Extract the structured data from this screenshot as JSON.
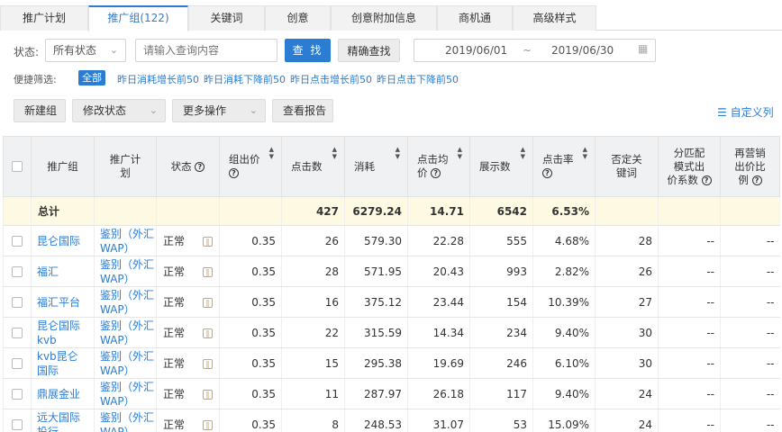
{
  "tabs": [
    {
      "label": "推广计划"
    },
    {
      "label": "推广组(122)"
    },
    {
      "label": "关键词"
    },
    {
      "label": "创意"
    },
    {
      "label": "创意附加信息"
    },
    {
      "label": "商机通"
    },
    {
      "label": "高级样式"
    }
  ],
  "filters": {
    "status_label": "状态:",
    "status_value": "所有状态",
    "search_placeholder": "请输入查询内容",
    "search_button": "查 找",
    "exact_button": "精确查找",
    "date_start": "2019/06/01",
    "date_sep": "~",
    "date_end": "2019/06/30"
  },
  "quick": {
    "label": "便捷筛选:",
    "all": "全部",
    "items": [
      "昨日消耗增长前50",
      "昨日消耗下降前50",
      "昨日点击增长前50",
      "昨日点击下降前50"
    ]
  },
  "actions": {
    "new_group": "新建组",
    "modify_status": "修改状态",
    "more_ops": "更多操作",
    "view_report": "查看报告",
    "custom_cols": "自定义列"
  },
  "table": {
    "headers": {
      "group": "推广组",
      "plan": [
        "推广计",
        "划"
      ],
      "status": "状态",
      "bid": "组出价",
      "clicks": "点击数",
      "cost": "消耗",
      "cpc": [
        "点击均",
        "价"
      ],
      "impr": "展示数",
      "ctr": "点击率",
      "negkw": [
        "否定关",
        "键词"
      ],
      "match": [
        "分匹配",
        "模式出",
        "价系数"
      ],
      "remarket": [
        "再营销",
        "出价比",
        "例"
      ]
    },
    "total": {
      "label": "总计",
      "clicks": "427",
      "cost": "6279.24",
      "cpc": "14.71",
      "impr": "6542",
      "ctr": "6.53%"
    },
    "rows": [
      {
        "group": [
          "昆仑国际"
        ],
        "plan": [
          "鉴别（外汇",
          "WAP）"
        ],
        "status": "正常",
        "bid": "0.35",
        "clicks": "26",
        "cost": "579.30",
        "cpc": "22.28",
        "impr": "555",
        "ctr": "4.68%",
        "negkw": "28",
        "match": "--",
        "remarket": "--"
      },
      {
        "group": [
          "福汇"
        ],
        "plan": [
          "鉴别（外汇",
          "WAP）"
        ],
        "status": "正常",
        "bid": "0.35",
        "clicks": "28",
        "cost": "571.95",
        "cpc": "20.43",
        "impr": "993",
        "ctr": "2.82%",
        "negkw": "26",
        "match": "--",
        "remarket": "--"
      },
      {
        "group": [
          "福汇平台"
        ],
        "plan": [
          "鉴别（外汇",
          "WAP）"
        ],
        "status": "正常",
        "bid": "0.35",
        "clicks": "16",
        "cost": "375.12",
        "cpc": "23.44",
        "impr": "154",
        "ctr": "10.39%",
        "negkw": "27",
        "match": "--",
        "remarket": "--"
      },
      {
        "group": [
          "昆仑国际",
          "kvb"
        ],
        "plan": [
          "鉴别（外汇",
          "WAP）"
        ],
        "status": "正常",
        "bid": "0.35",
        "clicks": "22",
        "cost": "315.59",
        "cpc": "14.34",
        "impr": "234",
        "ctr": "9.40%",
        "negkw": "30",
        "match": "--",
        "remarket": "--"
      },
      {
        "group": [
          "kvb昆仑",
          "国际"
        ],
        "plan": [
          "鉴别（外汇",
          "WAP）"
        ],
        "status": "正常",
        "bid": "0.35",
        "clicks": "15",
        "cost": "295.38",
        "cpc": "19.69",
        "impr": "246",
        "ctr": "6.10%",
        "negkw": "30",
        "match": "--",
        "remarket": "--"
      },
      {
        "group": [
          "鼎展金业"
        ],
        "plan": [
          "鉴别（外汇",
          "WAP）"
        ],
        "status": "正常",
        "bid": "0.35",
        "clicks": "11",
        "cost": "287.97",
        "cpc": "26.18",
        "impr": "117",
        "ctr": "9.40%",
        "negkw": "24",
        "match": "--",
        "remarket": "--"
      },
      {
        "group": [
          "远大国际",
          "投行"
        ],
        "plan": [
          "鉴别（外汇",
          "WAP）"
        ],
        "status": "正常",
        "bid": "0.35",
        "clicks": "8",
        "cost": "248.53",
        "cpc": "31.07",
        "impr": "53",
        "ctr": "15.09%",
        "negkw": "24",
        "match": "--",
        "remarket": "--"
      }
    ]
  },
  "colors": {
    "accent": "#2b7cd3",
    "total_row": "#fdf9e2",
    "pause": "#e6a23c"
  }
}
